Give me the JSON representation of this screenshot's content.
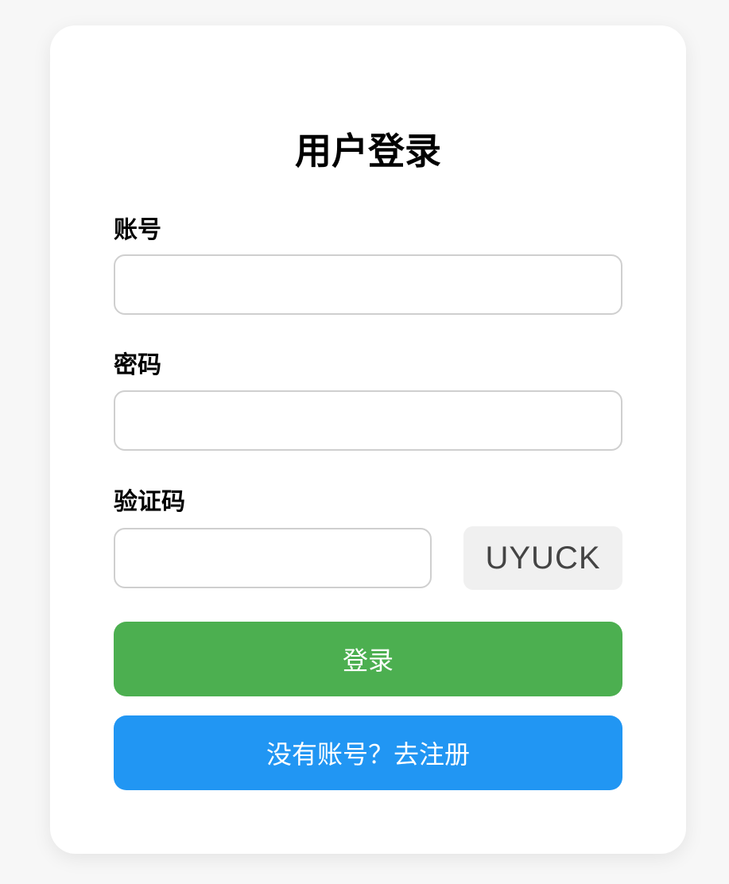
{
  "login_form": {
    "title": "用户登录",
    "account": {
      "label": "账号",
      "value": "",
      "placeholder": ""
    },
    "password": {
      "label": "密码",
      "value": "",
      "placeholder": ""
    },
    "captcha": {
      "label": "验证码",
      "value": "",
      "placeholder": "",
      "code": "UYUCK"
    },
    "login_label": "登录",
    "register_label": "没有账号？去注册"
  },
  "colors": {
    "background": "#f7f7f7",
    "card": "#ffffff",
    "login_button": "#4caf50",
    "register_button": "#2196f3",
    "captcha_bg": "#f0f0f0"
  }
}
